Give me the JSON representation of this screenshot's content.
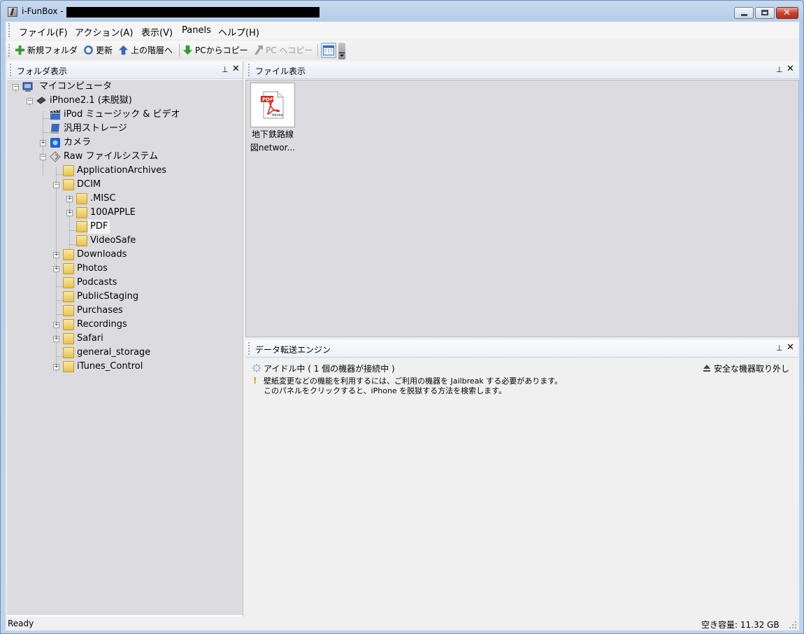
{
  "window": {
    "title": "i-FunBox -"
  },
  "menu": [
    {
      "label": "ファイル(F)"
    },
    {
      "label": "アクション(A)"
    },
    {
      "label": "表示(V)"
    },
    {
      "label": "Panels"
    },
    {
      "label": "ヘルプ(H)"
    }
  ],
  "toolbar": {
    "new_folder": "新規フォルダ",
    "refresh": "更新",
    "up": "上の階層へ",
    "copy_from_pc": "PCからコピー",
    "copy_to_pc": "PC へコピー"
  },
  "folder_pane": {
    "title": "フォルダ表示"
  },
  "tree": [
    {
      "label": "マイコンピュータ"
    },
    {
      "label": "iPhone2.1 (未脱獄)"
    },
    {
      "label": "iPod ミュージック & ビデオ"
    },
    {
      "label": "汎用ストレージ"
    },
    {
      "label": "カメラ"
    },
    {
      "label": "Raw ファイルシステム"
    },
    {
      "label": "ApplicationArchives"
    },
    {
      "label": "DCIM"
    },
    {
      "label": ".MISC"
    },
    {
      "label": "100APPLE"
    },
    {
      "label": "PDF"
    },
    {
      "label": "VideoSafe"
    },
    {
      "label": "Downloads"
    },
    {
      "label": "Photos"
    },
    {
      "label": "Podcasts"
    },
    {
      "label": "PublicStaging"
    },
    {
      "label": "Purchases"
    },
    {
      "label": "Recordings"
    },
    {
      "label": "Safari"
    },
    {
      "label": "general_storage"
    },
    {
      "label": "iTunes_Control"
    }
  ],
  "file_pane": {
    "title": "ファイル表示",
    "files": [
      {
        "name_line1": "地下鉄路線",
        "name_line2": "図networ...",
        "badge": "PDF",
        "brand": "Adobe"
      }
    ]
  },
  "transfer_pane": {
    "title": "データ転送エンジン",
    "idle_status": "アイドル中 ( 1 個の機器が接続中 )",
    "safe_remove": "安全な機器取り外し",
    "notice_line1": "壁紙変更などの機能を利用するには、ご利用の機器を Jailbreak する必要があります。",
    "notice_line2": "このパネルをクリックすると、iPhone を脱獄する方法を検索します。"
  },
  "status_bar": {
    "left": "Ready",
    "right": "空き容量: 11.32 GB"
  },
  "colors": {
    "pane_bg": "#dcdce0",
    "folder": "#e8c24e",
    "green_arrow": "#2f9a2f",
    "blue_arrow": "#3a65b5"
  }
}
